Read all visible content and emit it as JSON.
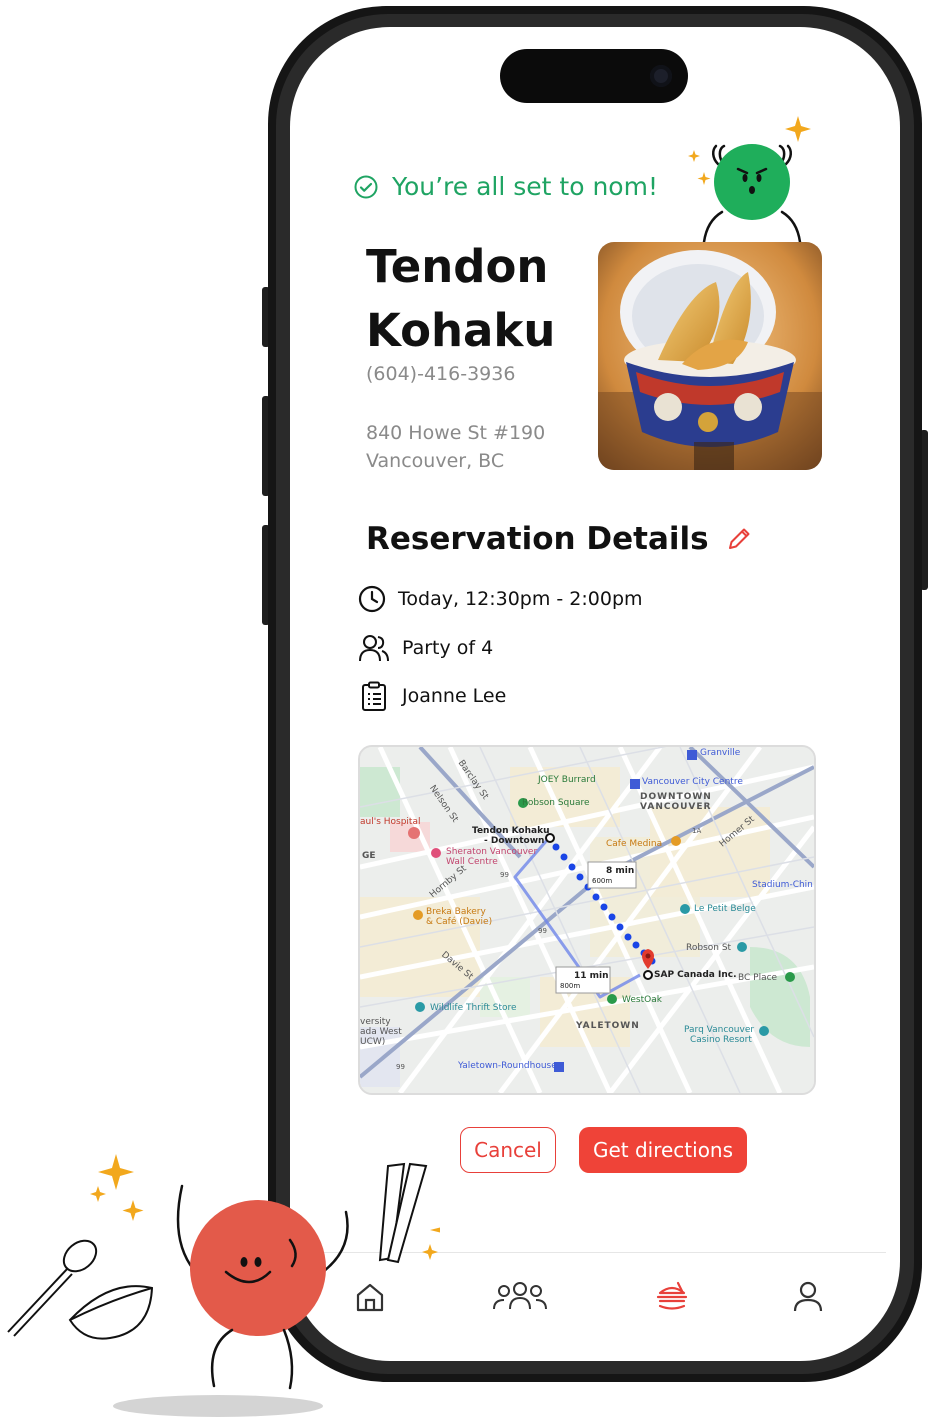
{
  "status": {
    "message": "You’re all set to nom!",
    "color": "#1fa463"
  },
  "restaurant": {
    "name_line1": "Tendon",
    "name_line2": "Kohaku",
    "phone": "(604)-416-3936",
    "address_line1": "840 Howe St #190",
    "address_line2": "Vancouver, BC"
  },
  "reservation": {
    "title": "Reservation Details",
    "time": "Today, 12:30pm - 2:00pm",
    "party": "Party of 4",
    "name": "Joanne Lee"
  },
  "map": {
    "labels": {
      "granville": "Granville",
      "joey": "JOEY Burrard",
      "vcc": "Vancouver City Centre",
      "downtown": "DOWNTOWN",
      "vancouver": "VANCOUVER",
      "robson_square": "Robson Square",
      "pauls": "aul's Hospital",
      "tendon_1": "Tendon Kohaku",
      "tendon_2": "- Downtown",
      "sheraton_1": "Sheraton Vancouver",
      "sheraton_2": "Wall Centre",
      "cafe_medina": "Cafe Medina",
      "stadium": "Stadium-Chin",
      "walk1_time": "8 min",
      "walk1_dist": "600m",
      "breka_1": "Breka Bakery",
      "breka_2": "& Café (Davie)",
      "petit_belge": "Le Petit Belge",
      "robson_st": "Robson St",
      "sap": "SAP Canada Inc.",
      "bc_place": "BC Place",
      "walk2_time": "11 min",
      "walk2_dist": "800m",
      "westoak": "WestOak",
      "wildlife": "Wildlife Thrift Store",
      "yaletown": "YALETOWN",
      "parq_1": "Parq Vancouver",
      "parq_2": "Casino Resort",
      "university_1": "versity",
      "university_2": "ada West",
      "university_3": "UCW)",
      "roundhouse": "Yaletown-Roundhouse",
      "ge": "GE",
      "hwy99_a": "99",
      "hwy99_b": "99",
      "hwy99_c": "99",
      "hwy1a": "1A",
      "nelson_st": "Nelson St",
      "hornby_st": "Hornby St",
      "davie_st": "Davie St",
      "homer_st": "Homer St",
      "barclay_st": "Barclay St"
    },
    "route_color": "#1a45e6",
    "pin_color": "#e23b2e"
  },
  "buttons": {
    "cancel": "Cancel",
    "directions": "Get directions",
    "accent": "#ef4338"
  },
  "tabs": [
    {
      "name": "home-icon"
    },
    {
      "name": "people-icon"
    },
    {
      "name": "reservation-food-icon"
    },
    {
      "name": "profile-icon"
    }
  ]
}
